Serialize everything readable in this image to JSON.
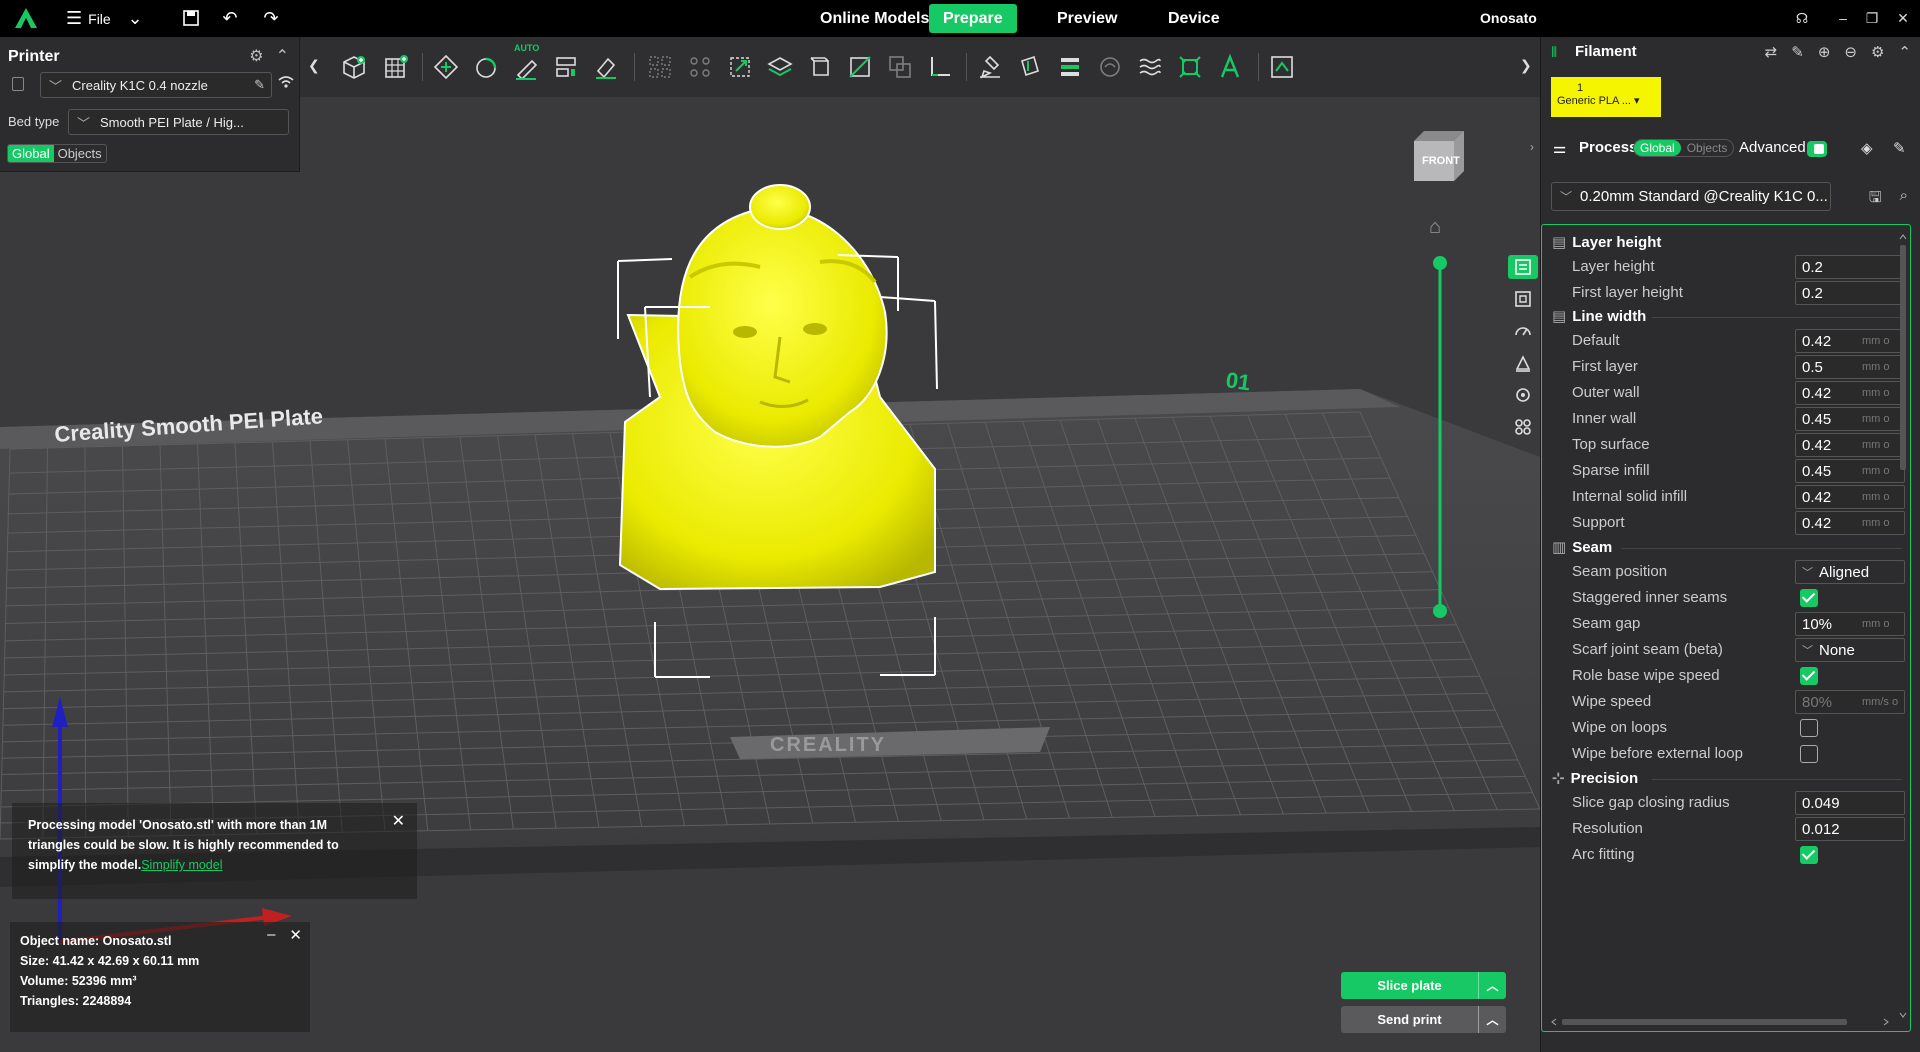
{
  "topbar": {
    "file_label": "File",
    "tabs": [
      {
        "label": "Online Models",
        "active": false
      },
      {
        "label": "Prepare",
        "active": true
      },
      {
        "label": "Preview",
        "active": false
      },
      {
        "label": "Device",
        "active": false
      }
    ],
    "project_title": "Onosato"
  },
  "printer_panel": {
    "title": "Printer",
    "printer_name": "Creality K1C 0.4 nozzle",
    "bed_type_label": "Bed type",
    "bed_type_value": "Smooth PEI Plate / Hig...",
    "scope_tabs": [
      {
        "label": "Global",
        "active": true
      },
      {
        "label": "Objects",
        "active": false
      }
    ]
  },
  "toolbar": {
    "auto_badge": "AUTO"
  },
  "viewport": {
    "view_cube_label": "FRONT",
    "plate_number": "01",
    "plate_text": "Creality Smooth PEI Plate",
    "plate_brand": "CREALITY",
    "model_color": "#f2f200",
    "notice": {
      "text": "Processing model 'Onosato.stl' with more than 1M triangles could be slow. It is highly recommended to simplify the model.",
      "link": "Simplify model"
    },
    "object_info": {
      "name": "Object name: Onosato.stl",
      "size": "Size: 41.42 x 42.69 x 60.11 mm",
      "volume": "Volume: 52396 mm³",
      "triangles": "Triangles: 2248894"
    },
    "slice_button": "Slice plate",
    "send_button": "Send print"
  },
  "filament": {
    "title": "Filament",
    "slot_number": "1",
    "slot_name": "Generic PLA ...",
    "slot_color": "#f5f500"
  },
  "process": {
    "title": "Process",
    "scope_tabs": [
      {
        "label": "Global",
        "active": true
      },
      {
        "label": "Objects",
        "active": false
      }
    ],
    "advanced_label": "Advanced",
    "advanced_on": true,
    "preset": "0.20mm Standard @Creality K1C 0..."
  },
  "settings": {
    "layer_height": {
      "title": "Layer height",
      "rows": [
        {
          "label": "Layer height",
          "value": "0.2"
        },
        {
          "label": "First layer height",
          "value": "0.2"
        }
      ]
    },
    "line_width": {
      "title": "Line width",
      "unit": "mm o",
      "rows": [
        {
          "label": "Default",
          "value": "0.42"
        },
        {
          "label": "First layer",
          "value": "0.5"
        },
        {
          "label": "Outer wall",
          "value": "0.42"
        },
        {
          "label": "Inner wall",
          "value": "0.45"
        },
        {
          "label": "Top surface",
          "value": "0.42"
        },
        {
          "label": "Sparse infill",
          "value": "0.45"
        },
        {
          "label": "Internal solid infill",
          "value": "0.42"
        },
        {
          "label": "Support",
          "value": "0.42"
        }
      ]
    },
    "seam": {
      "title": "Seam",
      "seam_position": {
        "label": "Seam position",
        "value": "Aligned"
      },
      "staggered": {
        "label": "Staggered inner seams",
        "checked": true
      },
      "seam_gap": {
        "label": "Seam gap",
        "value": "10%",
        "unit": "mm o"
      },
      "scarf": {
        "label": "Scarf joint seam (beta)",
        "value": "None"
      },
      "role_wipe": {
        "label": "Role base wipe speed",
        "checked": true
      },
      "wipe_speed": {
        "label": "Wipe speed",
        "value": "80%",
        "unit": "mm/s o"
      },
      "wipe_loops": {
        "label": "Wipe on loops",
        "checked": false
      },
      "wipe_before": {
        "label": "Wipe before external loop",
        "checked": false
      }
    },
    "precision": {
      "title": "Precision",
      "rows": [
        {
          "label": "Slice gap closing radius",
          "value": "0.049"
        },
        {
          "label": "Resolution",
          "value": "0.012"
        }
      ],
      "arc_fitting": {
        "label": "Arc fitting",
        "checked": true
      }
    }
  },
  "colors": {
    "accent": "#17c964",
    "panel": "#2c2c2e",
    "viewport": "#3a3a3c",
    "topbar": "#000000"
  }
}
